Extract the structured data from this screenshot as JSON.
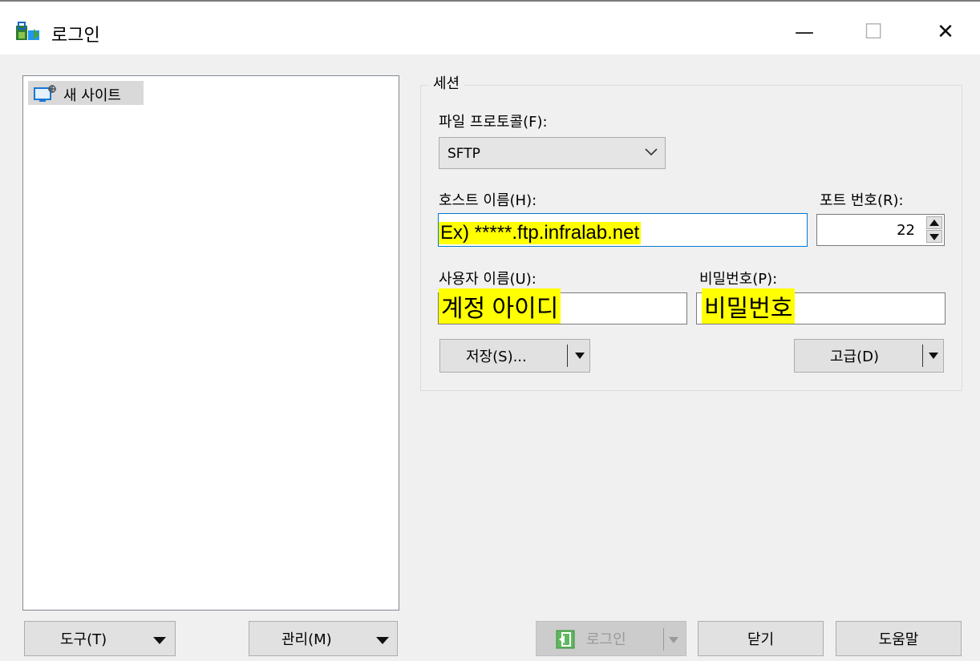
{
  "window": {
    "title": "로그인",
    "app_icon": "winscp-login-icon",
    "controls": [
      "minimize-icon",
      "maximize-icon",
      "close-icon"
    ],
    "minimize_glyph": "—",
    "maximize_glyph": "☐",
    "close_glyph": "✕"
  },
  "sites": {
    "items": [
      {
        "label": "새 사이트",
        "icon": "new-site-icon",
        "selected": true
      }
    ]
  },
  "session": {
    "group_title": "세션",
    "protocol_label": "파일 프로토콜(F):",
    "protocol_value": "SFTP",
    "host_label": "호스트 이름(H):",
    "host_value": "Ex) *****.ftp.infralab.net",
    "port_label": "포트 번호(R):",
    "port_value": "22",
    "user_label": "사용자 이름(U):",
    "user_value": "계정 아이디",
    "password_label": "비밀번호(P):",
    "password_value": "비밀번호",
    "save_button": "저장(S)...",
    "advanced_button": "고급(D)"
  },
  "bottom": {
    "tools_button": "도구(T)",
    "manage_button": "관리(M)",
    "login_button": "로그인",
    "close_button": "닫기",
    "help_button": "도움말"
  },
  "colors": {
    "highlight": "#ffff00",
    "focus_border": "#0078d7",
    "button_bg": "#e1e1e1",
    "window_bg": "#f0f0f0",
    "login_icon_green": "#4caf50"
  }
}
